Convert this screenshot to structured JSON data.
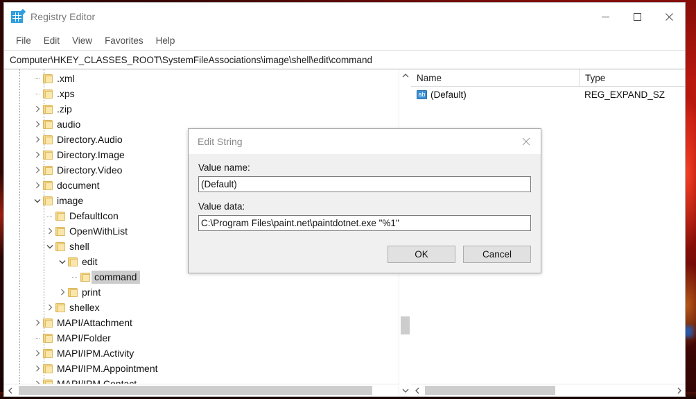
{
  "window": {
    "title": "Registry Editor",
    "icon": "registry-editor-icon",
    "controls": {
      "minimize": "minimize-icon",
      "maximize": "maximize-icon",
      "close": "close-icon"
    }
  },
  "menubar": {
    "items": [
      "File",
      "Edit",
      "View",
      "Favorites",
      "Help"
    ]
  },
  "address": {
    "path": "Computer\\HKEY_CLASSES_ROOT\\SystemFileAssociations\\image\\shell\\edit\\command"
  },
  "tree": {
    "items": [
      {
        "label": ".xml",
        "depth": 1,
        "expander": "none",
        "selected": false
      },
      {
        "label": ".xps",
        "depth": 1,
        "expander": "none",
        "selected": false
      },
      {
        "label": ".zip",
        "depth": 1,
        "expander": "collapsed",
        "selected": false
      },
      {
        "label": "audio",
        "depth": 1,
        "expander": "collapsed",
        "selected": false
      },
      {
        "label": "Directory.Audio",
        "depth": 1,
        "expander": "collapsed",
        "selected": false
      },
      {
        "label": "Directory.Image",
        "depth": 1,
        "expander": "collapsed",
        "selected": false
      },
      {
        "label": "Directory.Video",
        "depth": 1,
        "expander": "collapsed",
        "selected": false
      },
      {
        "label": "document",
        "depth": 1,
        "expander": "collapsed",
        "selected": false
      },
      {
        "label": "image",
        "depth": 1,
        "expander": "expanded",
        "selected": false
      },
      {
        "label": "DefaultIcon",
        "depth": 2,
        "expander": "none",
        "selected": false
      },
      {
        "label": "OpenWithList",
        "depth": 2,
        "expander": "collapsed",
        "selected": false
      },
      {
        "label": "shell",
        "depth": 2,
        "expander": "expanded",
        "selected": false
      },
      {
        "label": "edit",
        "depth": 3,
        "expander": "expanded",
        "selected": false
      },
      {
        "label": "command",
        "depth": 4,
        "expander": "none",
        "selected": true
      },
      {
        "label": "print",
        "depth": 3,
        "expander": "collapsed",
        "selected": false
      },
      {
        "label": "shellex",
        "depth": 2,
        "expander": "collapsed",
        "selected": false
      },
      {
        "label": "MAPI/Attachment",
        "depth": 1,
        "expander": "collapsed",
        "selected": false
      },
      {
        "label": "MAPI/Folder",
        "depth": 1,
        "expander": "none",
        "selected": false
      },
      {
        "label": "MAPI/IPM.Activity",
        "depth": 1,
        "expander": "collapsed",
        "selected": false
      },
      {
        "label": "MAPI/IPM.Appointment",
        "depth": 1,
        "expander": "collapsed",
        "selected": false
      },
      {
        "label": "MAPI/IPM.Contact",
        "depth": 1,
        "expander": "collapsed",
        "selected": false
      }
    ]
  },
  "list": {
    "columns": [
      "Name",
      "Type"
    ],
    "rows": [
      {
        "icon": "string-value-icon",
        "icon_text": "ab",
        "name": "(Default)",
        "type": "REG_EXPAND_SZ"
      }
    ]
  },
  "dialog": {
    "title": "Edit String",
    "close_icon": "close-icon",
    "value_name_label": "Value name:",
    "value_name": "(Default)",
    "value_data_label": "Value data:",
    "value_data": "C:\\Program Files\\paint.net\\paintdotnet.exe \"%1\"",
    "ok_label": "OK",
    "cancel_label": "Cancel"
  },
  "scrollbars": {
    "tree_vertical": {
      "up_icon": "chevron-up-icon",
      "down_icon": "chevron-down-icon"
    },
    "tree_horizontal": {
      "left_icon": "chevron-left-icon",
      "right_icon": "chevron-right-icon"
    },
    "list_horizontal": {
      "left_icon": "chevron-left-icon",
      "right_icon": "chevron-right-icon"
    }
  },
  "colors": {
    "accent": "#0078d7",
    "selection": "#cdcdcd",
    "folder": "#f6d77f",
    "string_icon": "#3b8fd4",
    "window_bg": "#ffffff",
    "dialog_bg": "#f0f0f0"
  }
}
